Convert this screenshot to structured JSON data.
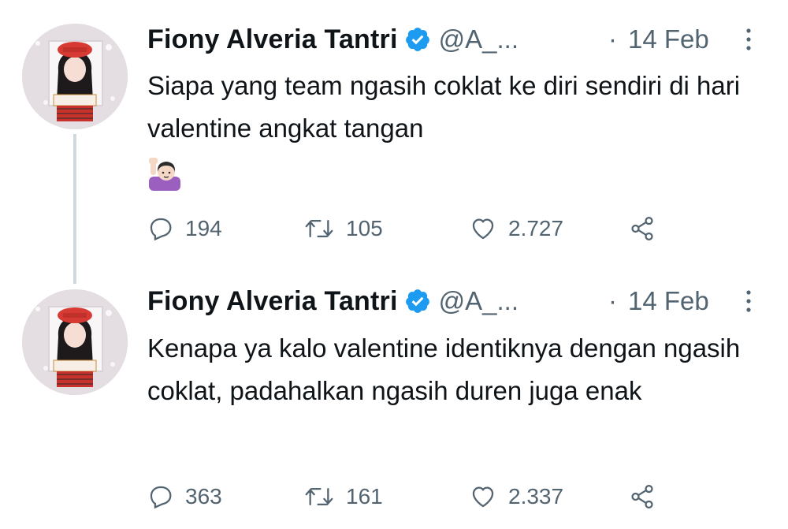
{
  "tweets": [
    {
      "author_name": "Fiony Alveria Tantri",
      "handle": "@A_...",
      "dot": "·",
      "date": "14 Feb",
      "text": "Siapa yang team ngasih coklat ke diri sendiri di hari valentine angkat tangan",
      "emoji": "raising-hand-woman-emoji",
      "avatar_caption": "FIONY",
      "replies": "194",
      "retweets": "105",
      "likes": "2.727"
    },
    {
      "author_name": "Fiony Alveria Tantri",
      "handle": "@A_...",
      "dot": "·",
      "date": "14 Feb",
      "text": "Kenapa ya kalo valentine identiknya dengan ngasih coklat, padahalkan ngasih duren juga enak",
      "avatar_caption": "FIONY",
      "replies": "363",
      "retweets": "161",
      "likes": "2.337"
    }
  ],
  "colors": {
    "text": "#0f1419",
    "secondary": "#536471",
    "verified": "#1d9bf0",
    "thread_line": "#cfd9de"
  },
  "icons": {
    "verified": "verified-badge-icon",
    "more": "more-options-icon",
    "reply": "reply-icon",
    "retweet": "retweet-icon",
    "like": "heart-icon",
    "share": "share-icon"
  }
}
